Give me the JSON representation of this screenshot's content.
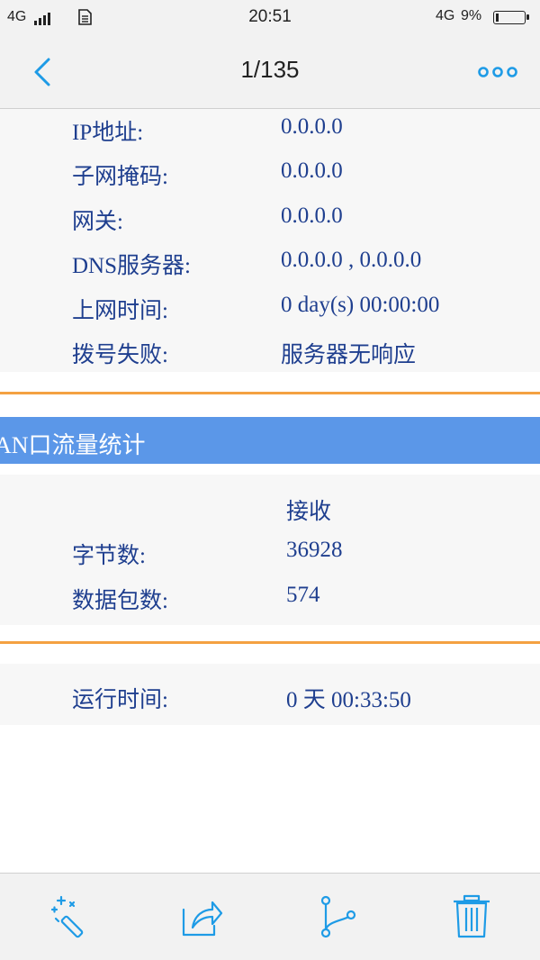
{
  "status_bar": {
    "signal_label": "4G",
    "time": "20:51",
    "network": "4G",
    "battery_percent": "9%",
    "battery_level": 0.09
  },
  "nav": {
    "title": "1/135",
    "back_icon": "chevron-left-icon",
    "more_icon": "more-dots-icon"
  },
  "wan_info": {
    "rows": [
      {
        "label": "IP地址:",
        "value": "0.0.0.0"
      },
      {
        "label": "子网掩码:",
        "value": "0.0.0.0"
      },
      {
        "label": "网关:",
        "value": "0.0.0.0"
      },
      {
        "label": "DNS服务器:",
        "value": "0.0.0.0 , 0.0.0.0"
      },
      {
        "label": "上网时间:",
        "value": "0 day(s) 00:00:00"
      },
      {
        "label": "拨号失败:",
        "value": "服务器无响应"
      }
    ]
  },
  "traffic": {
    "header": "AN口流量统计",
    "column_header": "接收",
    "rows": [
      {
        "label": "字节数:",
        "value": "36928"
      },
      {
        "label": "数据包数:",
        "value": "574"
      }
    ]
  },
  "uptime": {
    "label": "运行时间:",
    "value": "0 天 00:33:50"
  },
  "toolbar": {
    "items": [
      "magic-wand-icon",
      "share-icon",
      "branch-icon",
      "trash-icon"
    ]
  },
  "colors": {
    "accent": "#1e9be6",
    "text_blue": "#1f3f8f",
    "header_blue": "#5b97e8",
    "divider_orange": "#f4a142"
  }
}
